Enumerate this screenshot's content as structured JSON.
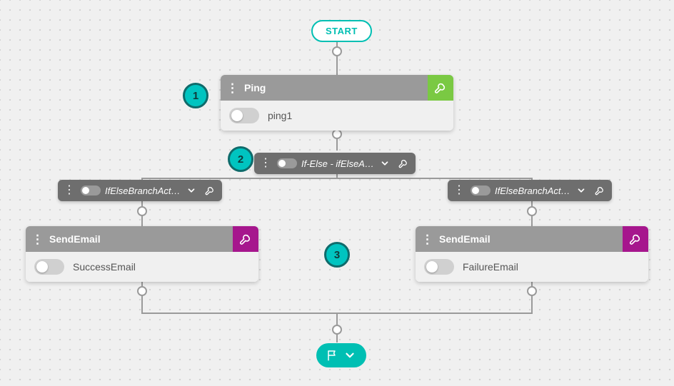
{
  "start": {
    "label": "START"
  },
  "annotations": {
    "a1": "1",
    "a2": "2",
    "a3": "3"
  },
  "ping": {
    "title": "Ping",
    "instance": "ping1"
  },
  "ifelse": {
    "label": "If-Else - ifElseA…"
  },
  "branchLeft": {
    "label": "IfElseBranchAct…"
  },
  "branchRight": {
    "label": "IfElseBranchAct…"
  },
  "emailLeft": {
    "title": "SendEmail",
    "instance": "SuccessEmail"
  },
  "emailRight": {
    "title": "SendEmail",
    "instance": "FailureEmail"
  }
}
